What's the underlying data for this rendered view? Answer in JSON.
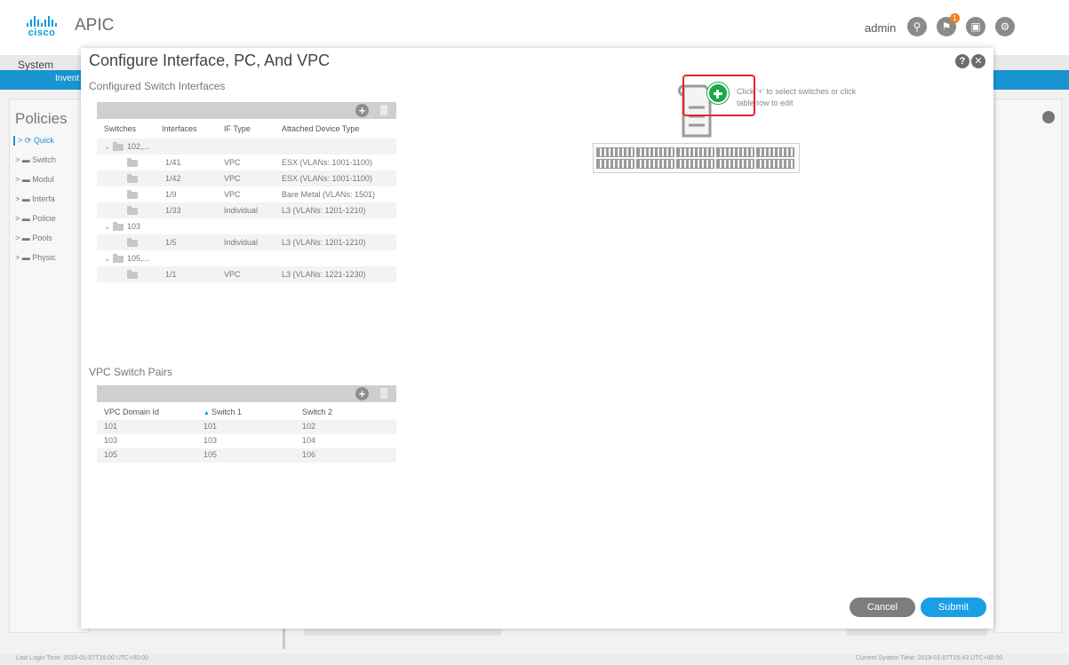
{
  "header": {
    "brand_word": "cisco",
    "app_title": "APIC",
    "user": "admin",
    "icons": [
      "search-icon",
      "alerts-icon",
      "feedback-icon",
      "settings-icon"
    ],
    "alert_count": "1"
  },
  "background": {
    "nav_label": "System",
    "blue_tab": "Invent",
    "sidebar_title": "Policies",
    "sidebar_items": [
      "Quick",
      "Switch",
      "Modul",
      "Interfa",
      "Policie",
      "Pools",
      "Physic"
    ]
  },
  "footer": {
    "last_login": "Last Login Time: 2019-01-07T15:00 UTC+00:00",
    "current_time": "Current System Time: 2019-01-07T15:43 UTC+00:00"
  },
  "modal": {
    "title": "Configure Interface, PC, And VPC",
    "interfaces_section_title": "Configured Switch Interfaces",
    "interfaces_columns": [
      "Switches",
      "Interfaces",
      "IF Type",
      "Attached Device Type"
    ],
    "interfaces_rows": [
      {
        "kind": "group",
        "switch": "102,..."
      },
      {
        "kind": "item",
        "interface": "1/41",
        "if_type": "VPC",
        "device": "ESX (VLANs: 1001-1100)"
      },
      {
        "kind": "item",
        "interface": "1/42",
        "if_type": "VPC",
        "device": "ESX (VLANs: 1001-1100)"
      },
      {
        "kind": "item",
        "interface": "1/9",
        "if_type": "VPC",
        "device": "Bare Metal (VLANs: 1501)"
      },
      {
        "kind": "item",
        "interface": "1/33",
        "if_type": "Individual",
        "device": "L3 (VLANs: 1201-1210)"
      },
      {
        "kind": "group",
        "switch": "103"
      },
      {
        "kind": "item",
        "interface": "1/5",
        "if_type": "Individual",
        "device": "L3 (VLANs: 1201-1210)"
      },
      {
        "kind": "group",
        "switch": "105,..."
      },
      {
        "kind": "item",
        "interface": "1/1",
        "if_type": "VPC",
        "device": "L3 (VLANs: 1221-1230)"
      }
    ],
    "vpc_section_title": "VPC Switch Pairs",
    "vpc_columns": [
      "VPC Domain Id",
      "Switch 1",
      "Switch 2"
    ],
    "vpc_rows": [
      [
        "101",
        "101",
        "102"
      ],
      [
        "103",
        "103",
        "104"
      ],
      [
        "105",
        "105",
        "106"
      ]
    ],
    "hint_line1": "Click '+' to select switches or click",
    "hint_line2": "table row to edit",
    "cancel_label": "Cancel",
    "submit_label": "Submit"
  }
}
